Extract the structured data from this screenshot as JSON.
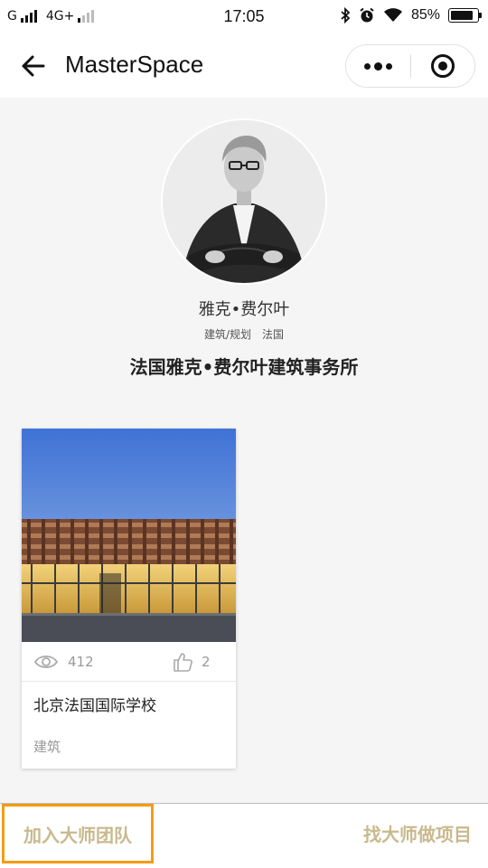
{
  "statusbar": {
    "carrier1": "G",
    "network": "4G+",
    "time": "17:05",
    "battery": "85%",
    "battery_level": 0.85
  },
  "navbar": {
    "title": "MasterSpace",
    "icons": [
      "back-arrow-icon",
      "more-dots-icon",
      "close-target-icon"
    ]
  },
  "profile": {
    "name": "雅克•费尔叶",
    "discipline": "建筑/规划",
    "country": "法国",
    "firm": "法国雅克•费尔叶建筑事务所"
  },
  "projects": [
    {
      "views": "412",
      "likes": "2",
      "title": "北京法国国际学校",
      "category": "建筑"
    }
  ],
  "bottombar": {
    "join_label": "加入大师团队",
    "find_label": "找大师做项目"
  },
  "colors": {
    "accent_gold": "#c9b98d",
    "highlight_orange": "#f39c12",
    "background": "#f5f5f5"
  }
}
